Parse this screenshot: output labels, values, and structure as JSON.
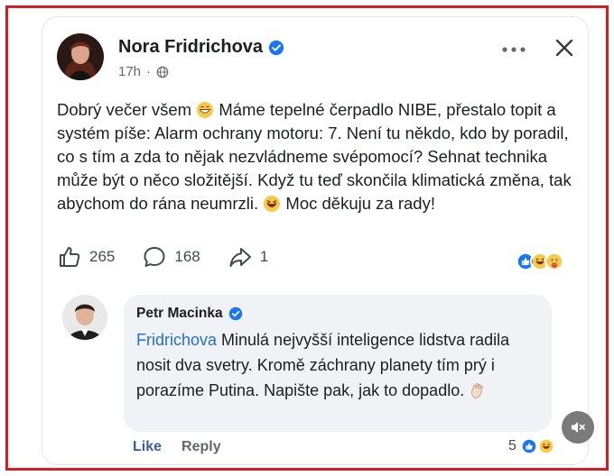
{
  "post": {
    "author": "Nora Fridrichova",
    "time": "17h",
    "separator": "·",
    "text_parts": [
      "Dobrý večer všem ",
      " Máme tepelné čerpadlo NIBE, přestalo topit a systém píše: Alarm ochrany motoru: 7. Není tu někdo, kdo by poradil, co s tím a zda to nějak nezvládneme svépomocí? Sehnat technika může být o něco složitější. Když tu teď skončila klimatická změna, tak abychom do rána neumrzli. ",
      " Moc děkuju za rady!"
    ],
    "likes": "265",
    "comments": "168",
    "shares": "1"
  },
  "comment": {
    "author": "Petr Macinka",
    "mention": "Fridrichova",
    "text": " Minulá nejvyšší inteligence lidstva radila nosit dva svetry. Kromě záchrany planety tím prý i porazíme Putina. Napište pak, jak to dopadlo. ",
    "like_label": "Like",
    "reply_label": "Reply",
    "reaction_count": "5"
  },
  "icons": {
    "verified": "verified-badge-icon",
    "globe": "globe-icon",
    "more": "more-options-icon",
    "close": "close-icon",
    "like": "thumbs-up-icon",
    "comment": "comment-icon",
    "share": "share-icon",
    "mute": "mute-audio-icon"
  },
  "colors": {
    "frame": "#d11f24",
    "verified": "#1877f2",
    "mention": "#216fdb",
    "bubble": "#f0f2f5"
  }
}
